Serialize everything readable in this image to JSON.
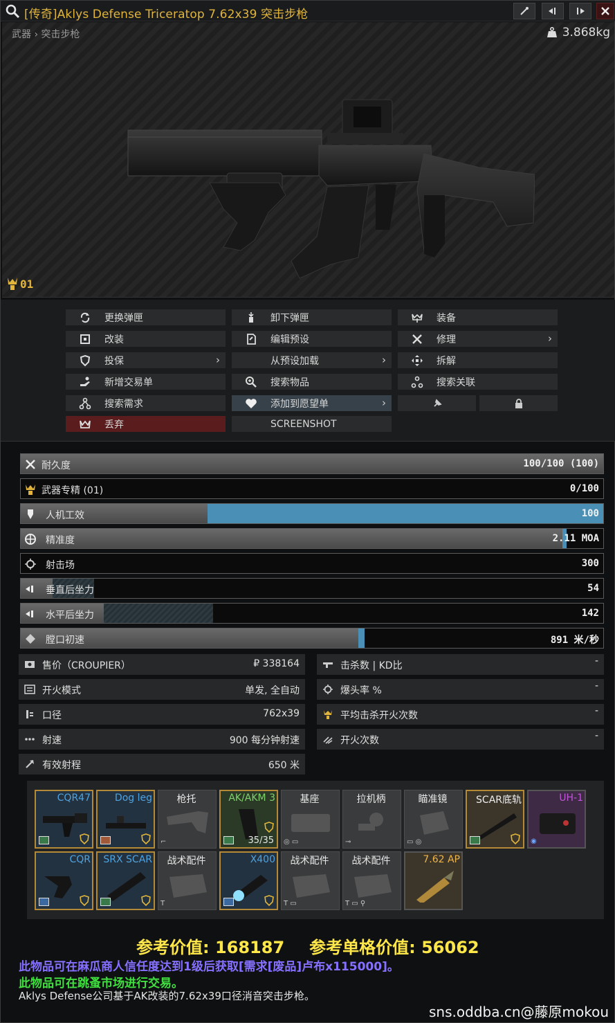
{
  "window": {
    "title": "[传奇]Aklys Defense Triceratop 7.62x39 突击步枪",
    "buttons": [
      "pin",
      "collapse-left",
      "expand-right",
      "close"
    ]
  },
  "breadcrumb": "武器 › 突击步枪",
  "weight": "3.868kg",
  "mastery_badge": "01",
  "menu": {
    "col1": [
      "更换弹匣",
      "改装",
      "投保",
      "新增交易单",
      "搜索需求",
      "丢弃"
    ],
    "col2": [
      "卸下弹匣",
      "编辑预设",
      "从预设加载",
      "搜索物品",
      "添加到愿望单",
      "SCREENSHOT"
    ],
    "col3": [
      "装备",
      "修理",
      "拆解",
      "搜索关联"
    ]
  },
  "stats": [
    {
      "label": "耐久度",
      "value": "100/100 (100)",
      "fill": 1.0
    },
    {
      "label": "武器专精 (01)",
      "value": "0/100",
      "fill": 0.0
    },
    {
      "label": "人机工效",
      "value": "100",
      "fill": 1.0
    },
    {
      "label": "精准度",
      "value": "2.11 MOA",
      "fill": 0.93
    },
    {
      "label": "射击场",
      "value": "300",
      "fill": 0.0
    },
    {
      "label": "垂直后坐力",
      "value": "54",
      "fill": 0.05
    },
    {
      "label": "水平后坐力",
      "value": "142",
      "fill": 0.14
    },
    {
      "label": "膛口初速",
      "value": "891 米/秒",
      "fill": 0.58
    }
  ],
  "info_left": [
    {
      "label": "售价（CROUPIER）",
      "value": "₽ 338164"
    },
    {
      "label": "开火模式",
      "value": "单发, 全自动"
    },
    {
      "label": "口径",
      "value": "762x39"
    },
    {
      "label": "射速",
      "value": "900 每分钟射速"
    },
    {
      "label": "有效射程",
      "value": "650 米"
    }
  ],
  "info_right": [
    {
      "label": "击杀数 | KD比",
      "value": "-"
    },
    {
      "label": "爆头率 %",
      "value": "-"
    },
    {
      "label": "平均击杀开火次数",
      "value": "-"
    },
    {
      "label": "开火次数",
      "value": "-"
    }
  ],
  "slots_row1": [
    "CQR47",
    "Dog leg",
    "枪托",
    "AK/AKM 3",
    "基座",
    "拉机柄",
    "瞄准镜",
    "SCAR底轨",
    "UH-1"
  ],
  "slots_row2": [
    "CQR",
    "SRX SCAR",
    "战术配件",
    "X400",
    "战术配件",
    "战术配件",
    "7.62 AP"
  ],
  "mag_count": "35/35",
  "reference_value": "参考价值: 168187",
  "reference_per_cell": "参考单格价值: 56062",
  "note_fence": "此物品可在麻瓜商人信任度达到1级后获取[需求[废品]卢布x115000]。",
  "note_flea": "此物品可在跳蚤市场进行交易。",
  "description": "Aklys Defense公司基于AK改装的7.62x39口径消音突击步枪。",
  "watermark": "sns.oddba.cn@藤原mokou"
}
